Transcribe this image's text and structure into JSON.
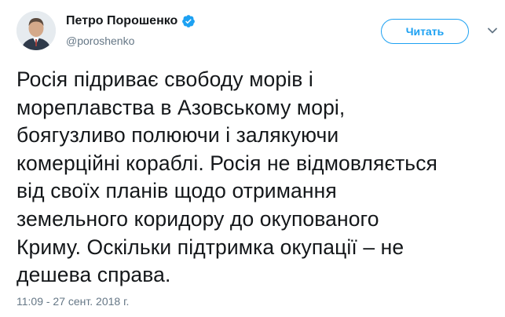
{
  "author": {
    "name": "Петро Порошенко",
    "handle": "@poroshenko",
    "verified": true
  },
  "follow_button": {
    "label": "Читать"
  },
  "icons": {
    "verified": "verified-badge-icon",
    "menu": "chevron-down-icon"
  },
  "tweet": {
    "lines": [
      "Росія підриває свободу морів і",
      "мореплавства в Азовському морі,",
      "боягузливо полюючи і залякуючи",
      "комерційні кораблі. Росія не відмовляється",
      "від своїх планів щодо отримання",
      "земельного коридору до окупованого",
      "Криму. Оскільки підтримка окупації – не",
      "дешева справа."
    ],
    "timestamp": "11:09 - 27 сент. 2018 г."
  },
  "colors": {
    "accent": "#1da1f2",
    "text": "#14171a",
    "muted": "#657786"
  }
}
